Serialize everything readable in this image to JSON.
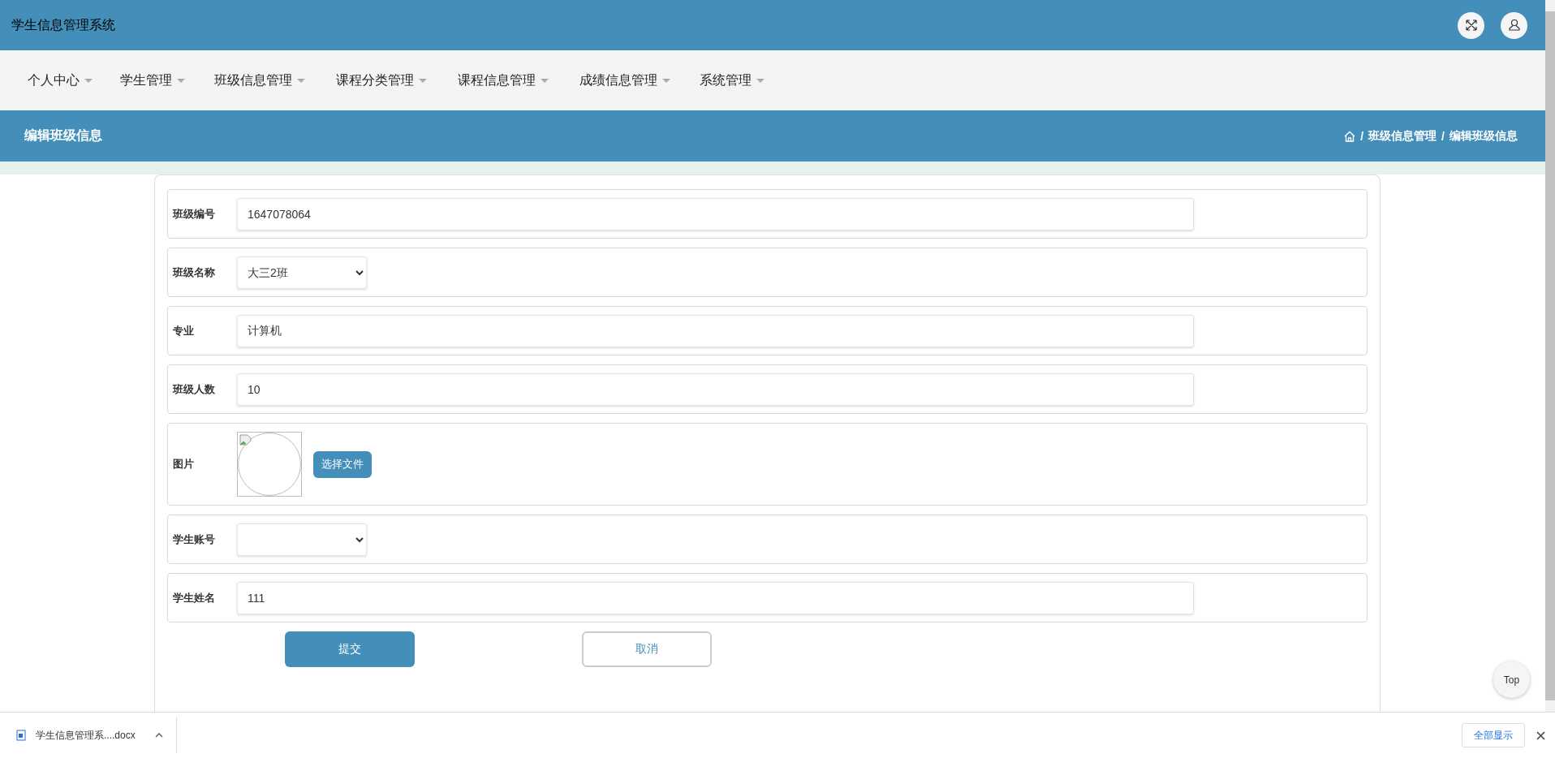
{
  "header": {
    "title": "学生信息管理系统"
  },
  "nav": [
    {
      "label": "个人中心"
    },
    {
      "label": "学生管理"
    },
    {
      "label": "班级信息管理"
    },
    {
      "label": "课程分类管理"
    },
    {
      "label": "课程信息管理"
    },
    {
      "label": "成绩信息管理"
    },
    {
      "label": "系统管理"
    }
  ],
  "page_header": {
    "title": "编辑班级信息",
    "separator": "/",
    "breadcrumb": [
      "班级信息管理",
      "编辑班级信息"
    ]
  },
  "form": {
    "fields": [
      {
        "kind": "text",
        "label": "班级编号",
        "value": "1647078064"
      },
      {
        "kind": "select",
        "label": "班级名称",
        "value": "大三2班"
      },
      {
        "kind": "text",
        "label": "专业",
        "value": "计算机"
      },
      {
        "kind": "text",
        "label": "班级人数",
        "value": "10"
      },
      {
        "kind": "image",
        "label": "图片",
        "button": "选择文件"
      },
      {
        "kind": "select",
        "label": "学生账号"
      },
      {
        "kind": "text",
        "label": "学生姓名",
        "value": "111"
      }
    ],
    "buttons": [
      {
        "kind": "primary",
        "label": "提交"
      },
      {
        "kind": "secondary",
        "label": "取消"
      }
    ]
  },
  "back_to_top": "Top",
  "download_bar": {
    "file": "学生信息管理系....docx",
    "show_all": "全部显示"
  }
}
